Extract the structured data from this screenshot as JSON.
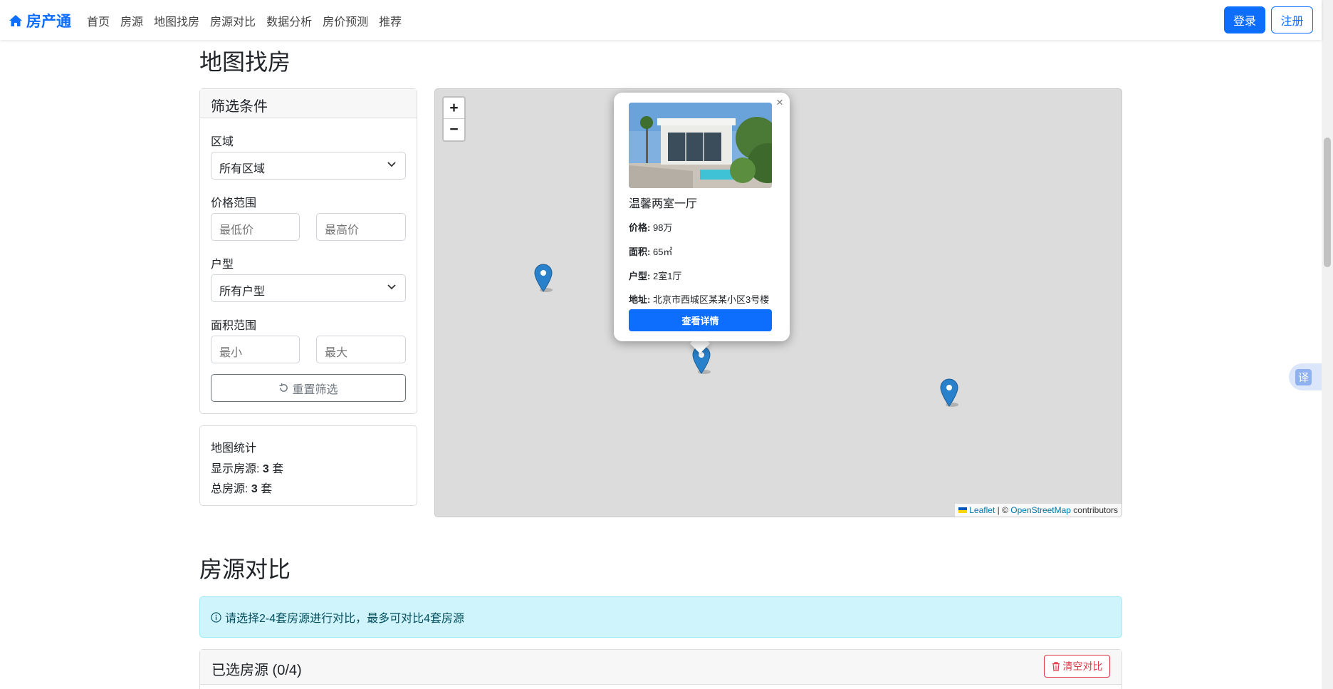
{
  "nav": {
    "brand": "房产通",
    "links": [
      "首页",
      "房源",
      "地图找房",
      "房源对比",
      "数据分析",
      "房价预测",
      "推荐"
    ],
    "login": "登录",
    "register": "注册"
  },
  "map_section": {
    "title": "地图找房",
    "filter": {
      "header": "筛选条件",
      "region_label": "区域",
      "region_value": "所有区域",
      "price_label": "价格范围",
      "price_min_placeholder": "最低价",
      "price_max_placeholder": "最高价",
      "layout_label": "户型",
      "layout_value": "所有户型",
      "area_label": "面积范围",
      "area_min_placeholder": "最小",
      "area_max_placeholder": "最大",
      "reset": "重置筛选"
    },
    "stats": {
      "title": "地图统计",
      "shown_prefix": "显示房源: ",
      "shown_count": "3",
      "shown_suffix": " 套",
      "total_prefix": "总房源: ",
      "total_count": "3",
      "total_suffix": " 套"
    },
    "map": {
      "zoom_in": "+",
      "zoom_out": "−",
      "attribution_leaflet": "Leaflet",
      "attribution_sep": " | © ",
      "attribution_osm": "OpenStreetMap",
      "attribution_suffix": " contributors"
    },
    "popup": {
      "close": "×",
      "title": "温馨两室一厅",
      "price_label": "价格:",
      "price_value": "98万",
      "area_label": "面积:",
      "area_value": "65㎡",
      "layout_label": "户型:",
      "layout_value": "2室1厅",
      "address_label": "地址:",
      "address_value": "北京市西城区某某小区3号楼",
      "detail_button": "查看详情"
    }
  },
  "compare_section": {
    "title": "房源对比",
    "alert": "请选择2-4套房源进行对比，最多可对比4套房源",
    "selected": "已选房源 (0/4)",
    "clear": "清空对比"
  },
  "translate": "译",
  "colors": {
    "primary": "#0d6efd",
    "info_bg": "#cff4fc",
    "danger": "#dc3545",
    "marker": "#2a81cb"
  }
}
